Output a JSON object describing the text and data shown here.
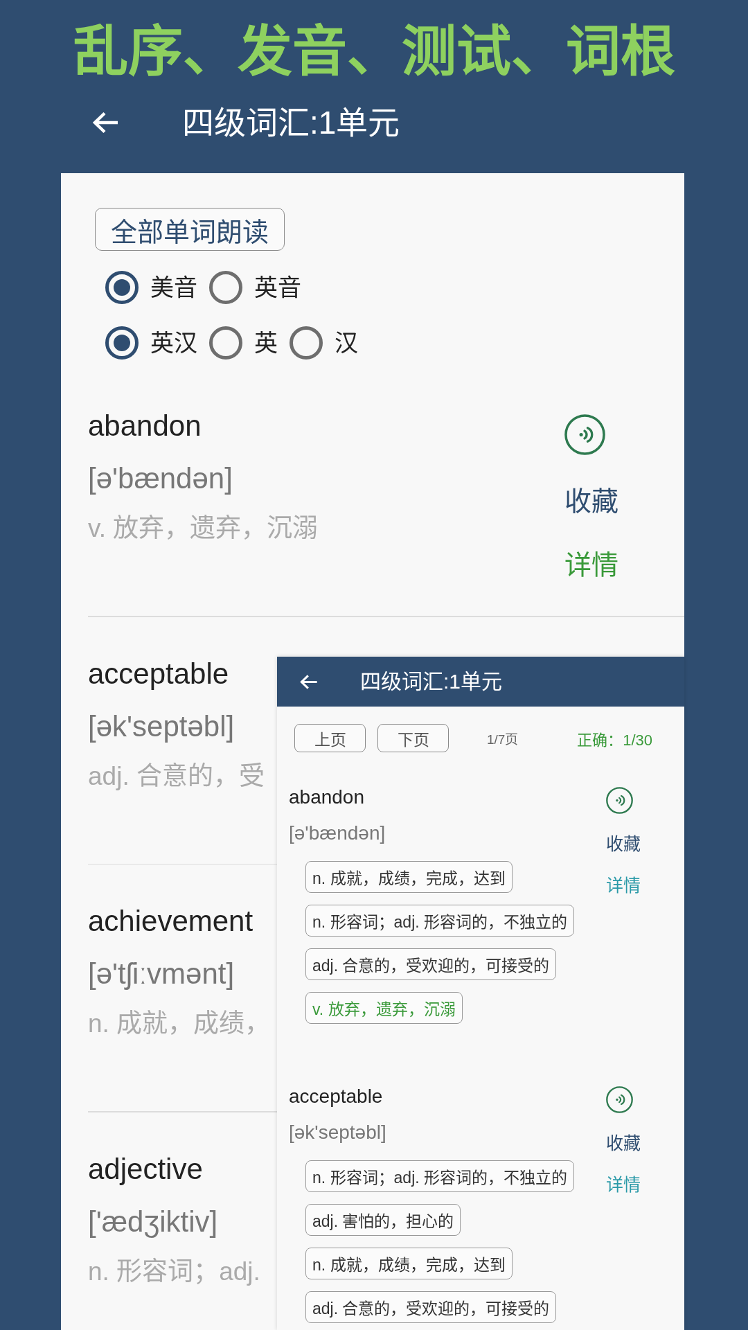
{
  "headline": "乱序、发音、测试、词根",
  "app_bar": {
    "title": "四级词汇:1单元"
  },
  "word_list": {
    "read_all_button": "全部单词朗读",
    "accent_options": [
      {
        "label": "美音",
        "selected": true
      },
      {
        "label": "英音",
        "selected": false
      }
    ],
    "display_options": [
      {
        "label": "英汉",
        "selected": true
      },
      {
        "label": "英",
        "selected": false
      },
      {
        "label": "汉",
        "selected": false
      }
    ],
    "words": [
      {
        "word": "abandon",
        "phonetic": "[ə'bændən]",
        "meaning": "v. 放弃，遗弃，沉溺",
        "favorite": "收藏",
        "details": "详情"
      },
      {
        "word": "acceptable",
        "phonetic": "[ək'septəbl]",
        "meaning": "adj. 合意的，受"
      },
      {
        "word": "achievement",
        "phonetic": "[ə'tʃiːvmənt]",
        "meaning": "n. 成就，成绩，"
      },
      {
        "word": "adjective",
        "phonetic": "['ædʒiktiv]",
        "meaning": "n. 形容词；adj."
      }
    ]
  },
  "quiz_inset": {
    "app_bar": {
      "title": "四级词汇:1单元"
    },
    "prev_button": "上页",
    "next_button": "下页",
    "page_indicator": "1/7页",
    "score": "正确：1/30",
    "words": [
      {
        "word": "abandon",
        "phonetic": "[ə'bændən]",
        "favorite": "收藏",
        "details": "详情",
        "choices": [
          {
            "text": "n. 成就，成绩，完成，达到",
            "correct": false
          },
          {
            "text": "n. 形容词；adj. 形容词的，不独立的",
            "correct": false
          },
          {
            "text": "adj. 合意的，受欢迎的，可接受的",
            "correct": false
          },
          {
            "text": "v. 放弃，遗弃，沉溺",
            "correct": true
          }
        ]
      },
      {
        "word": "acceptable",
        "phonetic": "[ək'septəbl]",
        "favorite": "收藏",
        "details": "详情",
        "choices": [
          {
            "text": "n. 形容词；adj. 形容词的，不独立的",
            "correct": false
          },
          {
            "text": "adj. 害怕的，担心的",
            "correct": false
          },
          {
            "text": "n. 成就，成绩，完成，达到",
            "correct": false
          },
          {
            "text": "adj. 合意的，受欢迎的，可接受的",
            "correct": false
          }
        ]
      }
    ]
  }
}
